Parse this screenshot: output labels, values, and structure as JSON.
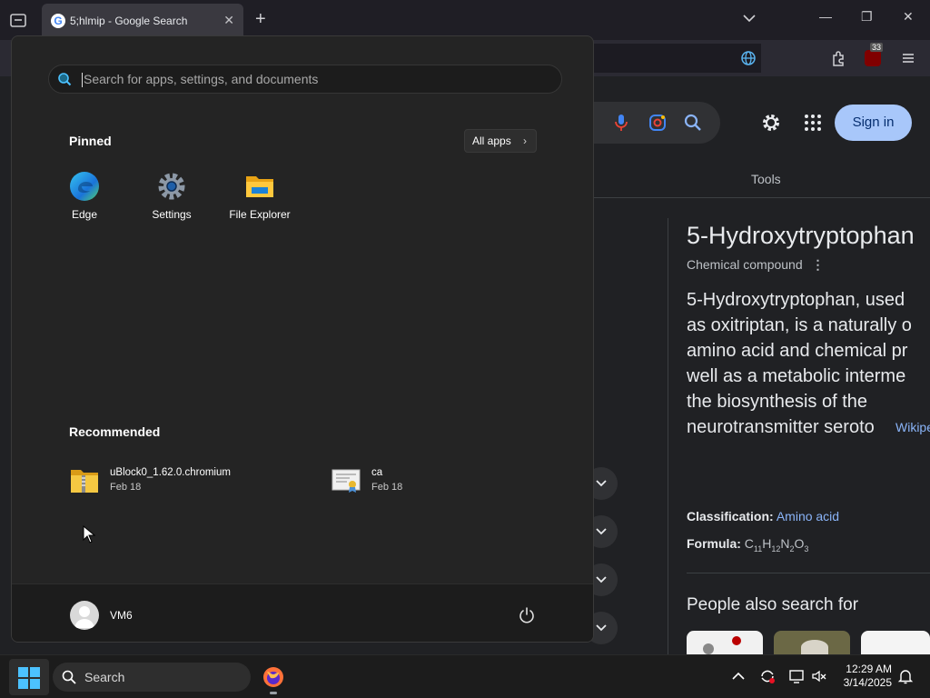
{
  "browser": {
    "tab_title": "5;hlmip - Google Search",
    "extension_badge": "33"
  },
  "google": {
    "signin_label": "Sign in",
    "tools_label": "Tools",
    "kp_title": "5-Hydroxytryptophan",
    "kp_subtitle": "Chemical compound",
    "kp_description_lines": [
      "5-Hydroxytryptophan, used",
      "as oxitriptan, is a naturally o",
      "amino acid and chemical pr",
      "well as a metabolic interme",
      "the biosynthesis of the",
      "neurotransmitter seroto"
    ],
    "wiki_link": "Wikipe",
    "classification_label": "Classification:",
    "classification_value": "Amino acid",
    "formula_label": "Formula:",
    "formula_parts": [
      "C",
      "11",
      "H",
      "12",
      "N",
      "2",
      "O",
      "3"
    ],
    "people_also_search": "People also search for"
  },
  "start_menu": {
    "search_placeholder": "Search for apps, settings, and documents",
    "pinned_heading": "Pinned",
    "all_apps_label": "All apps",
    "pinned": [
      {
        "label": "Edge",
        "icon": "edge-icon"
      },
      {
        "label": "Settings",
        "icon": "settings-gear-icon"
      },
      {
        "label": "File Explorer",
        "icon": "folder-icon"
      }
    ],
    "recommended_heading": "Recommended",
    "recommended": [
      {
        "name": "uBlock0_1.62.0.chromium",
        "date": "Feb 18",
        "icon": "zip-folder-icon"
      },
      {
        "name": "ca",
        "date": "Feb 18",
        "icon": "certificate-icon"
      }
    ],
    "user_name": "VM6"
  },
  "taskbar": {
    "search_label": "Search",
    "time": "12:29 AM",
    "date": "3/14/2025"
  },
  "colors": {
    "start_bg": "#242424",
    "taskbar_bg": "#1c1c1c",
    "signin_bg": "#a8c7fa",
    "link": "#8ab4f8"
  }
}
